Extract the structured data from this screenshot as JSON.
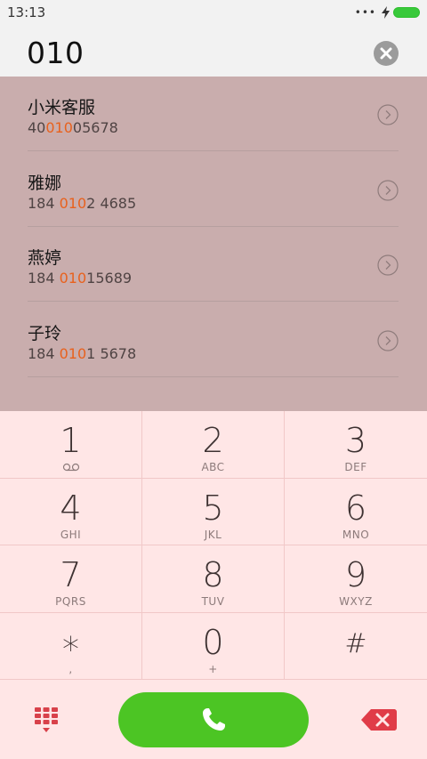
{
  "status": {
    "time": "13:13",
    "dots": "•••"
  },
  "dial": {
    "number": "010"
  },
  "contacts": [
    {
      "name": "小米客服",
      "num_pre": "40",
      "num_match": "010",
      "num_post": "05678"
    },
    {
      "name": "雅娜",
      "num_pre": "184 ",
      "num_match": "010",
      "num_post": "2 4685"
    },
    {
      "name": "燕婷",
      "num_pre": "184 ",
      "num_match": "010",
      "num_post": "15689"
    },
    {
      "name": "子玲",
      "num_pre": "184 ",
      "num_match": "010",
      "num_post": "1 5678"
    }
  ],
  "keys": [
    {
      "digit": "1",
      "letters": ""
    },
    {
      "digit": "2",
      "letters": "ABC"
    },
    {
      "digit": "3",
      "letters": "DEF"
    },
    {
      "digit": "4",
      "letters": "GHI"
    },
    {
      "digit": "5",
      "letters": "JKL"
    },
    {
      "digit": "6",
      "letters": "MNO"
    },
    {
      "digit": "7",
      "letters": "PQRS"
    },
    {
      "digit": "8",
      "letters": "TUV"
    },
    {
      "digit": "9",
      "letters": "WXYZ"
    },
    {
      "digit": "*",
      "letters": ","
    },
    {
      "digit": "0",
      "letters": "+"
    },
    {
      "digit": "#",
      "letters": ""
    }
  ],
  "icons": {
    "voicemail": "voicemail-icon",
    "clear": "clear-icon",
    "detail": "chevron-right-circle-icon",
    "dialpad": "dialpad-icon",
    "call": "phone-icon",
    "backspace": "backspace-icon",
    "charging": "lightning-icon",
    "battery": "battery-icon"
  },
  "colors": {
    "highlight": "#e8611d",
    "call_button": "#4cc524",
    "backspace": "#e03c48",
    "results_bg": "#c9adad",
    "dialpad_bg": "#ffe6e6"
  }
}
